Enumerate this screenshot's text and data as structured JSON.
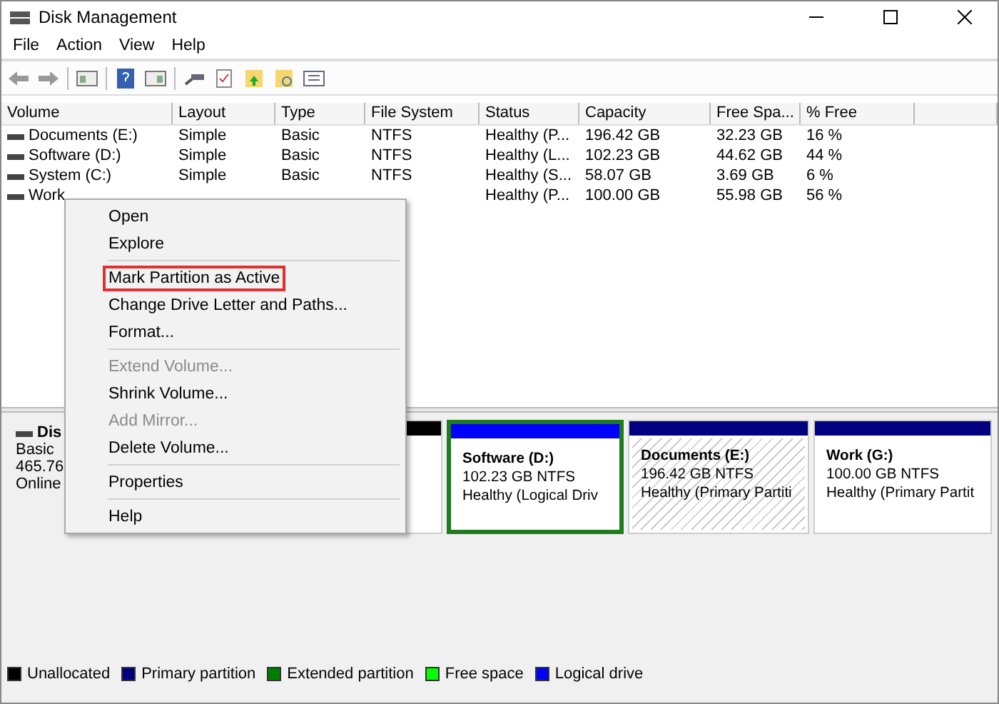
{
  "window": {
    "title": "Disk Management"
  },
  "menu_bar": [
    "File",
    "Action",
    "View",
    "Help"
  ],
  "table": {
    "columns": [
      "Volume",
      "Layout",
      "Type",
      "File System",
      "Status",
      "Capacity",
      "Free Spa...",
      "% Free"
    ],
    "rows": [
      {
        "cells": [
          "Documents (E:)",
          "Simple",
          "Basic",
          "NTFS",
          "Healthy (P...",
          "196.42 GB",
          "32.23 GB",
          "16 %"
        ]
      },
      {
        "cells": [
          "Software (D:)",
          "Simple",
          "Basic",
          "NTFS",
          "Healthy (L...",
          "102.23 GB",
          "44.62 GB",
          "44 %"
        ]
      },
      {
        "cells": [
          "System (C:)",
          "Simple",
          "Basic",
          "NTFS",
          "Healthy (S...",
          "58.07 GB",
          "3.69 GB",
          "6 %"
        ]
      },
      {
        "cells": [
          "Work",
          "",
          "",
          "",
          "Healthy (P...",
          "100.00 GB",
          "55.98 GB",
          "56 %"
        ]
      }
    ]
  },
  "disk": {
    "name": "Dis",
    "type": "Basic",
    "size": "465.76",
    "status": "Online",
    "partitions": [
      {
        "color": "#000000",
        "hatched": false,
        "framed": false
      },
      {
        "name": "Software  (D:)",
        "size": "102.23 GB NTFS",
        "status": "Healthy (Logical Driv",
        "color": "#0000ff",
        "hatched": false,
        "framed": true
      },
      {
        "name": "Documents  (E:)",
        "size": "196.42 GB NTFS",
        "status": "Healthy (Primary Partiti",
        "color": "#000080",
        "hatched": true,
        "framed": false
      },
      {
        "name": "Work  (G:)",
        "size": "100.00 GB NTFS",
        "status": "Healthy (Primary Partit",
        "color": "#000080",
        "hatched": false,
        "framed": false
      }
    ]
  },
  "context_menu": [
    {
      "kind": "item",
      "label": "Open",
      "disabled": false,
      "outlined": false
    },
    {
      "kind": "item",
      "label": "Explore",
      "disabled": false,
      "outlined": false
    },
    {
      "kind": "separator"
    },
    {
      "kind": "item",
      "label": "Mark Partition as Active",
      "disabled": false,
      "outlined": true
    },
    {
      "kind": "item",
      "label": "Change Drive Letter and Paths...",
      "disabled": false,
      "outlined": false
    },
    {
      "kind": "item",
      "label": "Format...",
      "disabled": false,
      "outlined": false
    },
    {
      "kind": "separator"
    },
    {
      "kind": "item",
      "label": "Extend Volume...",
      "disabled": true,
      "outlined": false
    },
    {
      "kind": "item",
      "label": "Shrink Volume...",
      "disabled": false,
      "outlined": false
    },
    {
      "kind": "item",
      "label": "Add Mirror...",
      "disabled": true,
      "outlined": false
    },
    {
      "kind": "item",
      "label": "Delete Volume...",
      "disabled": false,
      "outlined": false
    },
    {
      "kind": "separator"
    },
    {
      "kind": "item",
      "label": "Properties",
      "disabled": false,
      "outlined": false
    },
    {
      "kind": "separator"
    },
    {
      "kind": "item",
      "label": "Help",
      "disabled": false,
      "outlined": false
    }
  ],
  "legend": [
    {
      "label": "Unallocated",
      "color": "#000000"
    },
    {
      "label": "Primary partition",
      "color": "#000080"
    },
    {
      "label": "Extended partition",
      "color": "#008000"
    },
    {
      "label": "Free space",
      "color": "#00ff00"
    },
    {
      "label": "Logical drive",
      "color": "#0000ff"
    }
  ]
}
